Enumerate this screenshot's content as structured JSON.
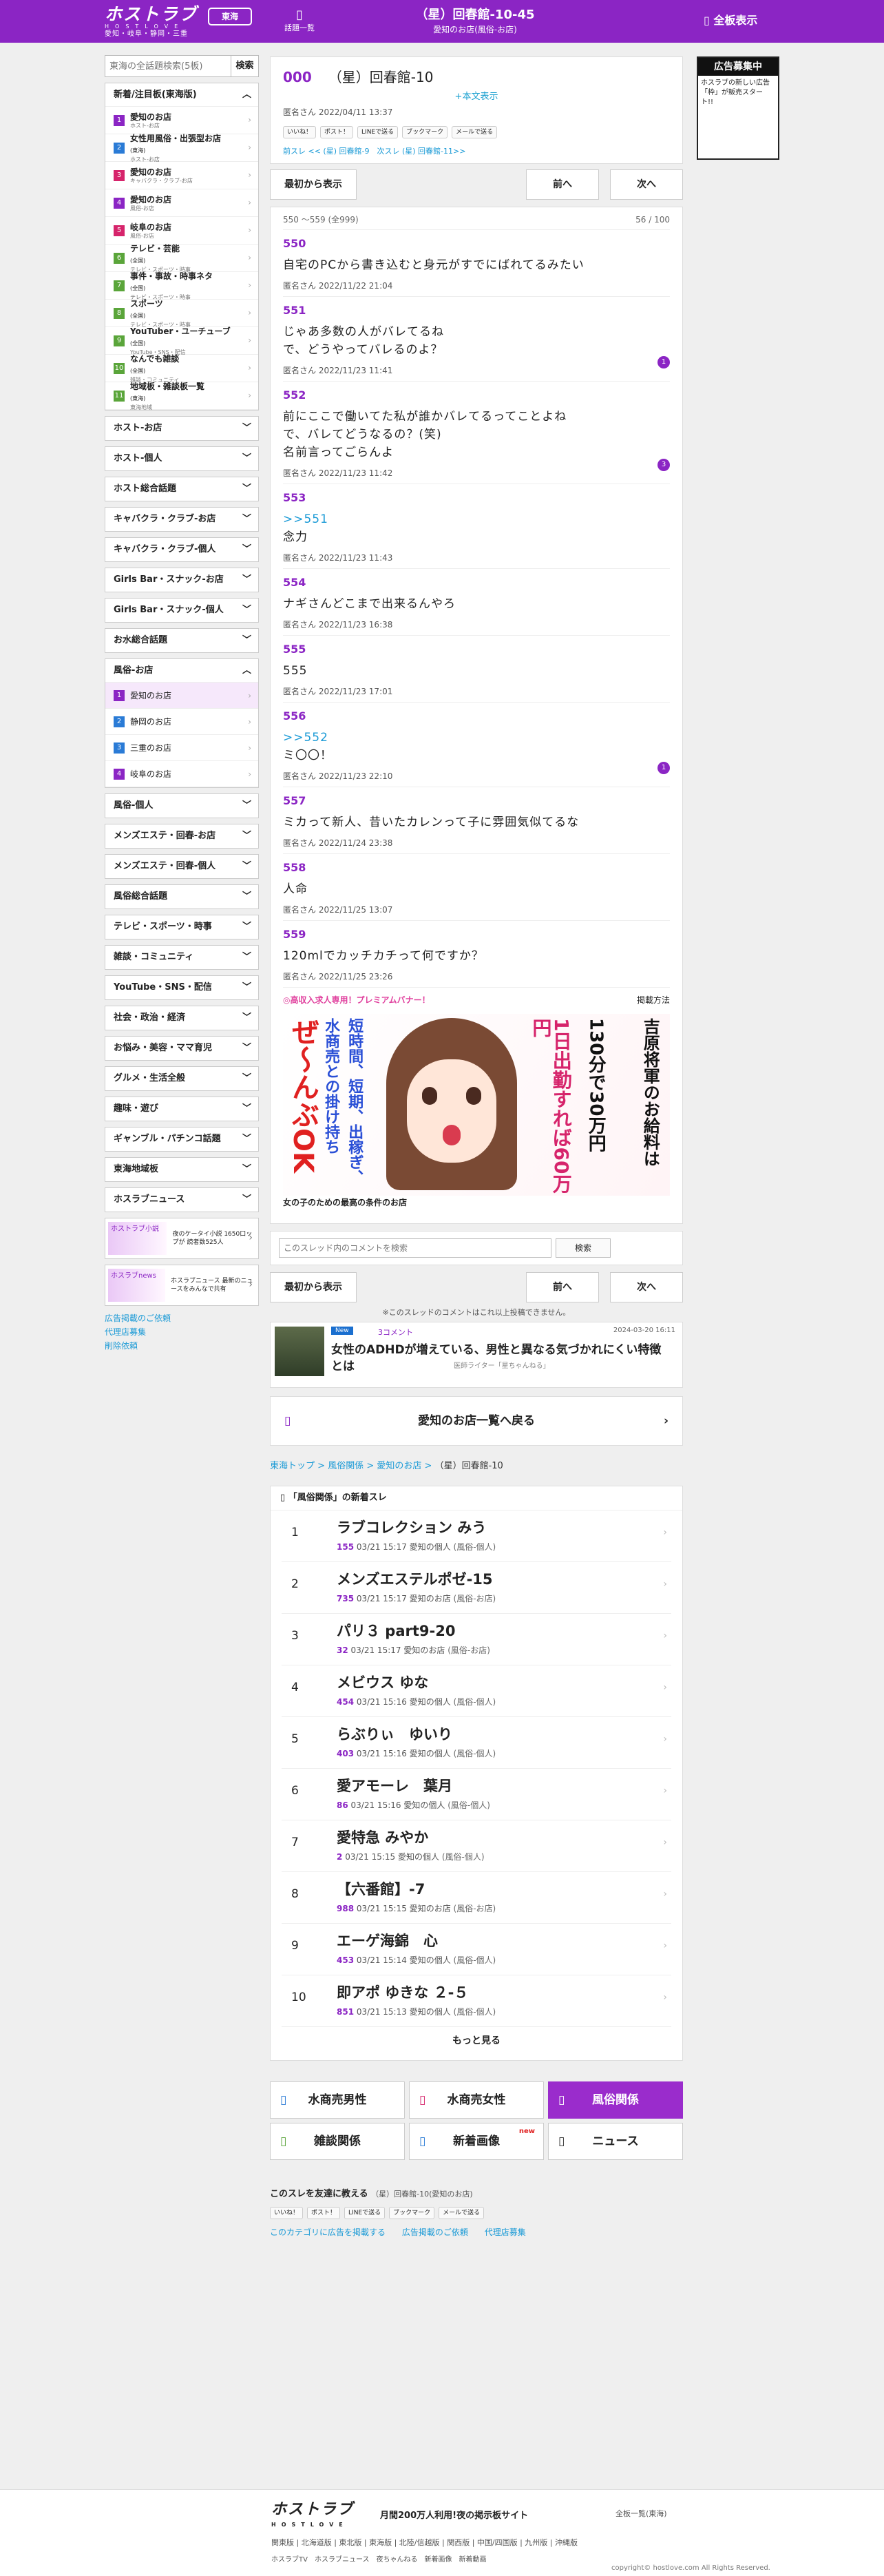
{
  "header": {
    "logo": "ホストラブ",
    "logo_sub": "HOSTLOVE",
    "logo_region": "愛知・岐阜・静岡・三重",
    "area": "東海",
    "menu_label": "話題一覧",
    "title": "（星）回春館-10-45",
    "subtitle": "愛知のお店(風俗-お店)",
    "full_label": "全板表示"
  },
  "sidebar": {
    "search_placeholder": "東海の全話題検索(5板)",
    "search_button": "検索",
    "open_section": {
      "title": "新着/注目板(東海版)",
      "items": [
        {
          "no": "1",
          "color": "#8b25c4",
          "label": "愛知のお店",
          "sub": "ホスト-お店"
        },
        {
          "no": "2",
          "color": "#2a7bd6",
          "label": "女性用風俗・出張型お店",
          "sub": "ホスト-お店",
          "tag": "(東海)"
        },
        {
          "no": "3",
          "color": "#d6246b",
          "label": "愛知のお店",
          "sub": "キャバクラ・クラブ-お店"
        },
        {
          "no": "4",
          "color": "#8b25c4",
          "label": "愛知のお店",
          "sub": "風俗-お店"
        },
        {
          "no": "5",
          "color": "#d6246b",
          "label": "岐阜のお店",
          "sub": "風俗-お店"
        },
        {
          "no": "6",
          "color": "#5aa53a",
          "label": "テレビ・芸能",
          "sub": "テレビ・スポーツ・時事",
          "tag": "(全国)"
        },
        {
          "no": "7",
          "color": "#5aa53a",
          "label": "事件・事故・時事ネタ",
          "sub": "テレビ・スポーツ・時事",
          "tag": "(全国)"
        },
        {
          "no": "8",
          "color": "#5aa53a",
          "label": "スポーツ",
          "sub": "テレビ・スポーツ・時事",
          "tag": "(全国)"
        },
        {
          "no": "9",
          "color": "#5aa53a",
          "label": "YouTuber・ユーチューブ",
          "sub": "YouTube・SNS・配信",
          "tag": "(全国)"
        },
        {
          "no": "10",
          "color": "#5aa53a",
          "label": "なんでも雑談",
          "sub": "雑談・コミュニティ",
          "tag": "(全国)"
        },
        {
          "no": "11",
          "color": "#5aa53a",
          "label": "地域板・雑談板一覧",
          "sub": "東海地域",
          "tag": "(東海)"
        }
      ]
    },
    "sections_a": [
      "ホスト-お店",
      "ホスト-個人",
      "ホスト総合話題",
      "キャバクラ・クラブ-お店",
      "キャバクラ・クラブ-個人",
      "Girls Bar・スナック-お店",
      "Girls Bar・スナック-個人",
      "お水総合話題"
    ],
    "fuzoku": {
      "title": "風俗-お店",
      "items": [
        {
          "no": "1",
          "color": "#8b25c4",
          "label": "愛知のお店"
        },
        {
          "no": "2",
          "color": "#2a7bd6",
          "label": "静岡のお店"
        },
        {
          "no": "3",
          "color": "#2a7bd6",
          "label": "三重のお店"
        },
        {
          "no": "4",
          "color": "#8b25c4",
          "label": "岐阜のお店"
        }
      ]
    },
    "sections_b": [
      "風俗-個人",
      "メンズエステ・回春-お店",
      "メンズエステ・回春-個人",
      "風俗総合話題",
      "テレビ・スポーツ・時事",
      "雑談・コミュニティ",
      "YouTube・SNS・配信",
      "社会・政治・経済",
      "お悩み・美容・ママ育児",
      "グルメ・生活全般",
      "趣味・遊び",
      "ギャンブル・パチンコ話題",
      "東海地域板",
      "ホスラブニュース"
    ],
    "banners": [
      {
        "img": "ホストラブ小説",
        "cap": "夜のケータイ小説 1650口ップが 読者数525人"
      },
      {
        "img": "ホスラブnews",
        "cap": "ホスラブニュース 最新のニュースをみんなで共有"
      }
    ],
    "links": [
      "広告掲載のご依頼",
      "代理店募集",
      "削除依頼"
    ]
  },
  "thread": {
    "no": "000",
    "title": "（星）回春館-10",
    "more": "+本文表示",
    "author": "匿名さん",
    "date": "2022/04/11 13:37",
    "sns": [
      "いいね！",
      "ポスト！",
      "LINEで送る",
      "ブックマーク",
      "メールで送る"
    ],
    "prev": "前スレ << (星) 回春館-9",
    "next": "次スレ (星) 回春館-11>>"
  },
  "pager": {
    "first": "最初から表示",
    "prev": "前へ",
    "next": "次へ"
  },
  "range": {
    "label": "550 〜559 (全999)",
    "page": "56 / 100"
  },
  "posts": [
    {
      "no": "550",
      "anchor": "",
      "text": "自宅のPCから書き込むと身元がすでにばれてるみたい",
      "meta": "匿名さん 2022/11/22 21:04",
      "replies": ""
    },
    {
      "no": "551",
      "anchor": "",
      "text": "じゃあ多数の人がバレてるね\nで、どうやってバレるのよ？",
      "meta": "匿名さん 2022/11/23 11:41",
      "replies": "1"
    },
    {
      "no": "552",
      "anchor": "",
      "text": "前にここで働いてた私が誰かバレてるってことよね\nで、バレてどうなるの？(笑)\n名前言ってごらんよ",
      "meta": "匿名さん 2022/11/23 11:42",
      "replies": "3"
    },
    {
      "no": "553",
      "anchor": ">>551",
      "text": "念力",
      "meta": "匿名さん 2022/11/23 11:43",
      "replies": ""
    },
    {
      "no": "554",
      "anchor": "",
      "text": "ナギさんどこまで出来るんやろ",
      "meta": "匿名さん 2022/11/23 16:38",
      "replies": ""
    },
    {
      "no": "555",
      "anchor": "",
      "text": "555",
      "meta": "匿名さん 2022/11/23 17:01",
      "replies": ""
    },
    {
      "no": "556",
      "anchor": ">>552",
      "text": "ミ〇〇！",
      "meta": "匿名さん 2022/11/23 22:10",
      "replies": "1"
    },
    {
      "no": "557",
      "anchor": "",
      "text": "ミカって新人、昔いたカレンって子に雰囲気似てるな",
      "meta": "匿名さん 2022/11/24 23:38",
      "replies": ""
    },
    {
      "no": "558",
      "anchor": "",
      "text": "人命",
      "meta": "匿名さん 2022/11/25 13:07",
      "replies": ""
    },
    {
      "no": "559",
      "anchor": "",
      "text": "120mlでカッチカチって何ですか？",
      "meta": "匿名さん 2022/11/25 23:26",
      "replies": ""
    }
  ],
  "ad": {
    "label": "◎高収入求人専用！プレミアムバナー！",
    "method": "掲載方法",
    "v1": "吉原将軍のお給料は",
    "v2": "130分で30万円",
    "v3": "1日出勤すれば60万円",
    "v4": "短時間、短期、出稼ぎ、",
    "v5": "水商売との掛け持ち",
    "v6": "ぜ〜んぶOK",
    "caption": "女の子のための最高の条件のお店"
  },
  "search": {
    "placeholder": "このスレッド内のコメントを検索",
    "button": "検索"
  },
  "end_note": "※このスレッドのコメントはこれ以上投稿できません。",
  "news": {
    "badge": "New",
    "comments": "3コメント",
    "date": "2024-03-20 16:11",
    "title": "女性のADHDが増えている、男性と異なる気づかれにくい特徴とは",
    "source": "医師ライター「星ちゃんねる」"
  },
  "back": {
    "label": "愛知のお店一覧へ戻る"
  },
  "crumb": {
    "a": "東海トップ",
    "b": "風俗関係",
    "c": "愛知のお店",
    "d": "（星）回春館-10"
  },
  "ranking": {
    "title": "「風俗関係」の新着スレ",
    "more": "もっと見る",
    "items": [
      {
        "n": "1",
        "t": "ラブコレクション みう",
        "c": "155",
        "d": "03/21 15:17",
        "s": "愛知の個人",
        "k": "(風俗-個人)"
      },
      {
        "n": "2",
        "t": "メンズエステルポゼ-15",
        "c": "735",
        "d": "03/21 15:17",
        "s": "愛知のお店",
        "k": "(風俗-お店)"
      },
      {
        "n": "3",
        "t": "パリ３ part9-20",
        "c": "32",
        "d": "03/21 15:17",
        "s": "愛知のお店",
        "k": "(風俗-お店)"
      },
      {
        "n": "4",
        "t": "メビウス ゆな",
        "c": "454",
        "d": "03/21 15:16",
        "s": "愛知の個人",
        "k": "(風俗-個人)"
      },
      {
        "n": "5",
        "t": "らぶりぃ　ゆいり",
        "c": "403",
        "d": "03/21 15:16",
        "s": "愛知の個人",
        "k": "(風俗-個人)"
      },
      {
        "n": "6",
        "t": "愛アモーレ　葉月",
        "c": "86",
        "d": "03/21 15:16",
        "s": "愛知の個人",
        "k": "(風俗-個人)"
      },
      {
        "n": "7",
        "t": "愛特急 みやか",
        "c": "2",
        "d": "03/21 15:15",
        "s": "愛知の個人",
        "k": "(風俗-個人)"
      },
      {
        "n": "8",
        "t": "【六番館】-7",
        "c": "988",
        "d": "03/21 15:15",
        "s": "愛知のお店",
        "k": "(風俗-お店)"
      },
      {
        "n": "9",
        "t": "エーゲ海錦　心",
        "c": "453",
        "d": "03/21 15:14",
        "s": "愛知の個人",
        "k": "(風俗-個人)"
      },
      {
        "n": "10",
        "t": "即アポ ゆきな ２-５",
        "c": "851",
        "d": "03/21 15:13",
        "s": "愛知の個人",
        "k": "(風俗-個人)"
      }
    ]
  },
  "cats": [
    {
      "label": "水商売男性",
      "icon": "▯",
      "color": "#2a7bd6"
    },
    {
      "label": "水商売女性",
      "icon": "▯",
      "color": "#d6246b"
    },
    {
      "label": "風俗関係",
      "icon": "▯",
      "color": "#fff",
      "active": true
    },
    {
      "label": "雑談関係",
      "icon": "▯",
      "color": "#5aa53a"
    },
    {
      "label": "新着画像",
      "icon": "▯",
      "color": "#2a7bd6",
      "new": "new"
    },
    {
      "label": "ニュース",
      "icon": "▯",
      "color": "#333"
    }
  ],
  "share": {
    "title": "このスレを友達に教える",
    "sub": "（星）回春館-10(愛知のお店)"
  },
  "footer_links": [
    "このカテゴリに広告を掲載する",
    "広告掲載のご依頼",
    "代理店募集"
  ],
  "footer": {
    "logo": "ホストラブ",
    "sub": "HOSTLOVE",
    "tagline": "月間200万人利用!夜の掲示板サイト",
    "switch": "全板一覧(東海)",
    "areas": "関東版 | 北海道版 | 東北版 | 東海版 | 北陸/信越版 | 関西版 | 中国/四国版 | 九州版 | 沖縄版",
    "icons": "ホスラブTV　ホスラブニュース　夜ちゃんねる　新着画像　新着動画",
    "copy": "copyright© hostlove.com All Rights Reserved."
  },
  "side_ad": {
    "head": "広告募集中",
    "body": "ホスラブの新しい広告「枠」が販売スタート!!"
  }
}
